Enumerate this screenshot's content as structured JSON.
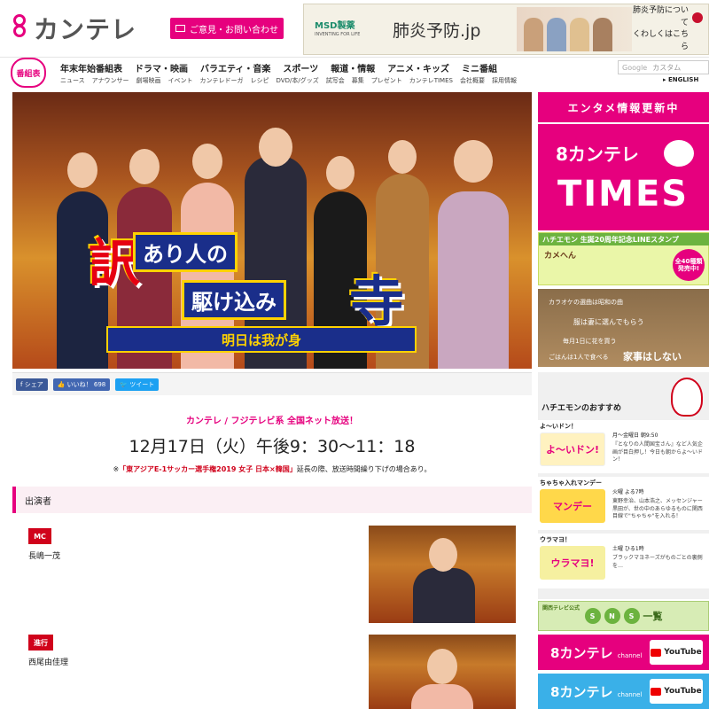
{
  "header": {
    "logo_text": "カンテレ",
    "contact_label": "ご意見・お問い合わせ",
    "ad": {
      "sponsor": "MSD製薬",
      "sponsor_tag": "INVENTING FOR LIFE",
      "headline": "肺炎予防.jp",
      "cta_line1": "肺炎予防について",
      "cta_line2": "くわしくはこちら"
    }
  },
  "nav": {
    "bangumi_label": "番組表",
    "main_items": [
      "年末年始番組表",
      "ドラマ・映画",
      "バラエティ・音楽",
      "スポーツ",
      "報道・情報",
      "アニメ・キッズ",
      "ミニ番組"
    ],
    "sub_items": [
      "ニュース",
      "アナウンサー",
      "劇場映画",
      "イベント",
      "カンテレドーガ",
      "レシピ",
      "DVD/本/グッズ",
      "試写会",
      "募集",
      "プレゼント",
      "カンテレTIMES",
      "会社概要",
      "採用情報"
    ],
    "search_placeholder": "カスタム",
    "search_brand": "Google",
    "english_label": "ENGLISH"
  },
  "hero": {
    "title_char1": "訳",
    "title_line1": "あり人の",
    "title_line2": "駆け込み",
    "title_char2": "寺",
    "title_band": "明日は我が身"
  },
  "share": {
    "fb_label": "シェア",
    "like_label": "いいね！ 698",
    "tweet_label": "ツイート"
  },
  "program": {
    "broadcast": "カンテレ / フジテレビ系 全国ネット放送！",
    "airtime": "12月17日（火）午後9：30〜11：18",
    "notice_prefix": "※",
    "notice_highlight": "「東アジアE-1サッカー選手権2019 女子 日本×韓国」",
    "notice_suffix": "延長の際、放送時間繰り下げの場合あり。"
  },
  "cast": {
    "section_title": "出演者",
    "roles": [
      {
        "tag": "MC",
        "name": "長嶋一茂"
      },
      {
        "tag": "進行",
        "name": "西尾由佳理"
      }
    ]
  },
  "sidebar": {
    "entame_head": "エンタメ情報更新中",
    "times_logo": "カンテレ",
    "times_text": "TIMES",
    "stamp_strip": "ハチエモン 生誕20周年記念LINEスタンプ",
    "stamp_chars": "カメへん",
    "stamp_badge": "全40種類 発売中!",
    "kaji": {
      "l1": "カラオケの選曲は昭和の曲",
      "l2": "服は妻に選んでもらう",
      "l3": "毎月1日に花を買う",
      "l4": "ごはんは1人で食べる",
      "l5": "家事はしない"
    },
    "reco_title": "ハチエモンのおすすめ",
    "reco_items": [
      {
        "title": "よ〜いドン！",
        "thumb": "よ〜いドン!",
        "sched": "月〜金曜日 朝9:50",
        "desc": "『となりの人間国宝さん』など人気企画が目白押し！今日も朝からよ〜いドン！"
      },
      {
        "title": "ちゃちゃ入れマンデー",
        "thumb": "マンデー",
        "sched": "火曜 よる7時",
        "desc": "東野幸治、山本浩之、メッセンジャー黒田が、世の中のあらゆるものに関西目線で\"ちゃちゃ\"を入れる！"
      },
      {
        "title": "ウラマヨ！",
        "thumb": "ウラマヨ!",
        "sched": "土曜 ひる1時",
        "desc": "ブラックマヨネーズがものごとの裏側を…"
      }
    ],
    "sns_small": "関西テレビ公式",
    "sns_letters": [
      "S",
      "N",
      "S"
    ],
    "sns_label": "一覧",
    "yt_logo": "カンテレ",
    "yt_channel": "channel",
    "yt_label": "YouTube"
  },
  "colors": {
    "brand": "#e6007e",
    "nav_title": "#1a2e8a",
    "alert": "#d0021b"
  }
}
